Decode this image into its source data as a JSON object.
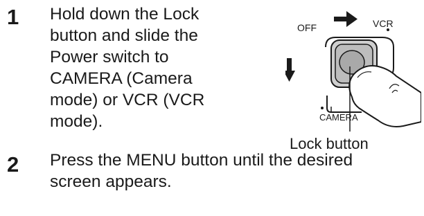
{
  "steps": [
    {
      "number": "1",
      "lines": [
        "Hold down the Lock",
        "button and slide the",
        "Power switch to",
        "CAMERA (Camera",
        "mode) or VCR (VCR",
        "mode)."
      ]
    },
    {
      "number": "2",
      "lines": [
        "Press the MENU button until the desired",
        "screen appears."
      ]
    }
  ],
  "illustration": {
    "label_off": "OFF",
    "label_vcr": "VCR",
    "label_camera": "CAMERA",
    "caption": "Lock button"
  }
}
